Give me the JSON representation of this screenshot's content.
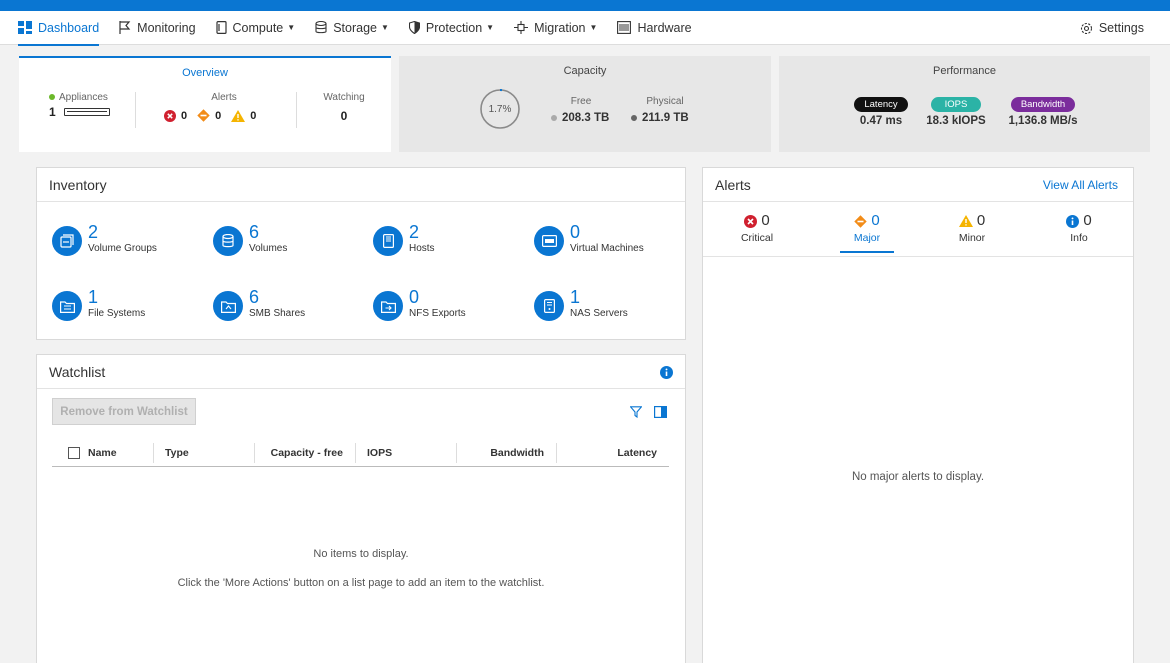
{
  "nav": {
    "items": [
      {
        "label": "Dashboard",
        "icon": "dashboard-icon",
        "active": true,
        "caret": false
      },
      {
        "label": "Monitoring",
        "icon": "flag-icon",
        "active": false,
        "caret": false
      },
      {
        "label": "Compute",
        "icon": "server-icon",
        "active": false,
        "caret": true
      },
      {
        "label": "Storage",
        "icon": "database-icon",
        "active": false,
        "caret": true
      },
      {
        "label": "Protection",
        "icon": "shield-icon",
        "active": false,
        "caret": true
      },
      {
        "label": "Migration",
        "icon": "migration-icon",
        "active": false,
        "caret": true
      },
      {
        "label": "Hardware",
        "icon": "hardware-icon",
        "active": false,
        "caret": false
      }
    ],
    "settings": "Settings"
  },
  "overview": {
    "title": "Overview",
    "appliances_label": "Appliances",
    "appliances_count": "1",
    "alerts_label": "Alerts",
    "alerts": {
      "critical": "0",
      "major": "0",
      "minor": "0"
    },
    "watching_label": "Watching",
    "watching_count": "0"
  },
  "capacity": {
    "title": "Capacity",
    "percent": "1.7%",
    "used_fraction": 0.017,
    "free_label": "Free",
    "free_value": "208.3 TB",
    "physical_label": "Physical",
    "physical_value": "211.9 TB"
  },
  "performance": {
    "title": "Performance",
    "latency_label": "Latency",
    "latency_value": "0.47 ms",
    "iops_label": "IOPS",
    "iops_value": "18.3 kIOPS",
    "bandwidth_label": "Bandwidth",
    "bandwidth_value": "1,136.8 MB/s",
    "colors": {
      "latency": "#111111",
      "iops": "#2bb3a6",
      "bandwidth": "#7b2d9c"
    }
  },
  "inventory": {
    "title": "Inventory",
    "items": [
      {
        "count": "2",
        "label": "Volume Groups",
        "icon": "volume-group-icon"
      },
      {
        "count": "6",
        "label": "Volumes",
        "icon": "volume-icon"
      },
      {
        "count": "2",
        "label": "Hosts",
        "icon": "host-icon"
      },
      {
        "count": "0",
        "label": "Virtual Machines",
        "icon": "vm-icon"
      },
      {
        "count": "1",
        "label": "File Systems",
        "icon": "file-system-icon"
      },
      {
        "count": "6",
        "label": "SMB Shares",
        "icon": "smb-share-icon"
      },
      {
        "count": "0",
        "label": "NFS Exports",
        "icon": "nfs-export-icon"
      },
      {
        "count": "1",
        "label": "NAS Servers",
        "icon": "nas-server-icon"
      }
    ]
  },
  "watchlist": {
    "title": "Watchlist",
    "remove_button": "Remove from Watchlist",
    "columns": [
      "Name",
      "Type",
      "Capacity - free",
      "IOPS",
      "Bandwidth",
      "Latency"
    ],
    "empty_title": "No items to display.",
    "empty_hint": "Click the 'More Actions' button on a list page to add an item to the watchlist."
  },
  "alerts": {
    "title": "Alerts",
    "view_all": "View All Alerts",
    "tabs": [
      {
        "count": "0",
        "label": "Critical",
        "icon": "critical-icon"
      },
      {
        "count": "0",
        "label": "Major",
        "icon": "major-icon"
      },
      {
        "count": "0",
        "label": "Minor",
        "icon": "minor-icon"
      },
      {
        "count": "0",
        "label": "Info",
        "icon": "info-icon"
      }
    ],
    "empty_message": "No major alerts to display."
  },
  "colors": {
    "accent": "#0a76d2",
    "critical": "#d0202f",
    "major": "#f28c18",
    "minor": "#f5b400",
    "info": "#0a76d2",
    "green": "#6bb82a"
  }
}
